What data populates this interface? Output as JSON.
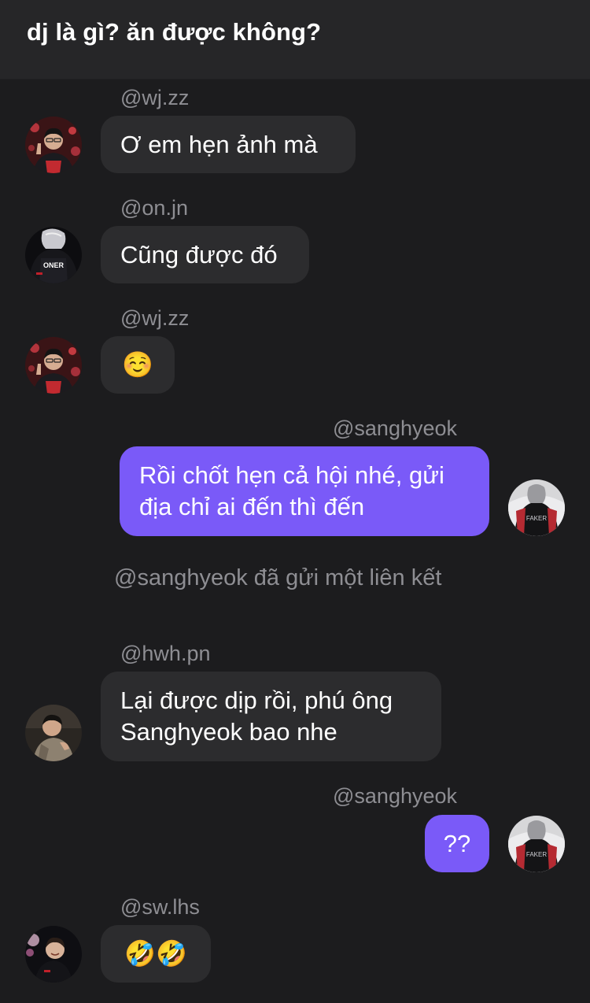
{
  "header": {
    "title": "dj là gì? ăn được không?"
  },
  "messages": [
    {
      "user": "@wj.zz",
      "text": "Ơ em hẹn ảnh mà",
      "direction": "in",
      "avatar": "avatar-wj-zz"
    },
    {
      "user": "@on.jn",
      "text": "Cũng được đó",
      "direction": "in",
      "avatar": "avatar-on-jn"
    },
    {
      "user": "@wj.zz",
      "text": "☺️",
      "direction": "in",
      "avatar": "avatar-wj-zz"
    },
    {
      "user": "@sanghyeok",
      "lines": [
        "Rồi chốt hẹn cả hội nhé, gửi",
        "địa chỉ ai đến thì đến"
      ],
      "direction": "out",
      "avatar": "avatar-sanghyeok"
    },
    {
      "system": "@sanghyeok đã gửi một liên kết"
    },
    {
      "user": "@hwh.pn",
      "lines": [
        "Lại được dịp rồi, phú ông",
        "Sanghyeok bao nhe"
      ],
      "direction": "in",
      "avatar": "avatar-hwh-pn"
    },
    {
      "user": "@sanghyeok",
      "text": "??",
      "direction": "out",
      "avatar": "avatar-sanghyeok"
    },
    {
      "user": "@sw.lhs",
      "text": "🤣🤣",
      "direction": "in",
      "avatar": "avatar-sw-lhs"
    }
  ],
  "avatar_labels": {
    "on_jn_jersey": "ONER",
    "sanghyeok_jacket": "FAKER"
  },
  "colors": {
    "background": "#1c1c1e",
    "header": "#262628",
    "incoming_bubble": "#2c2c2e",
    "outgoing_bubble": "#7a5af8",
    "secondary_text": "#8e8e93"
  }
}
